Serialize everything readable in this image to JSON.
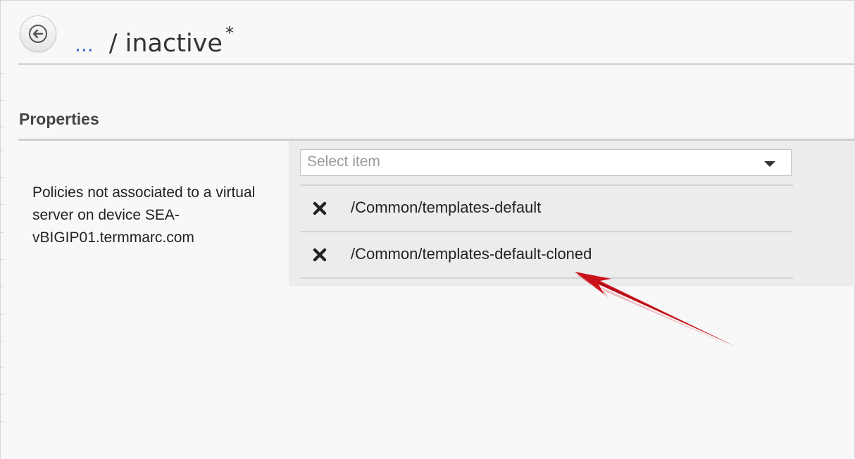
{
  "header": {
    "back_icon": "arrow-left-circle-icon",
    "breadcrumb_ellipsis": "...",
    "breadcrumb_separator": "/",
    "breadcrumb_current": "inactive",
    "modified_marker": "*"
  },
  "properties": {
    "section_title": "Properties",
    "field_label": "Policies not associated to a virtual server on device SEA-vBIGIP01.termmarc.com",
    "select": {
      "placeholder": "Select item",
      "caret_icon": "caret-down-icon"
    },
    "items": [
      {
        "label": "/Common/templates-default",
        "remove_icon": "close-x-icon"
      },
      {
        "label": "/Common/templates-default-cloned",
        "remove_icon": "close-x-icon"
      }
    ]
  },
  "colors": {
    "link": "#2c6cc7",
    "annotation_arrow": "#d9141b",
    "value_panel": "#ececec",
    "page_background": "#f8f8f8"
  }
}
